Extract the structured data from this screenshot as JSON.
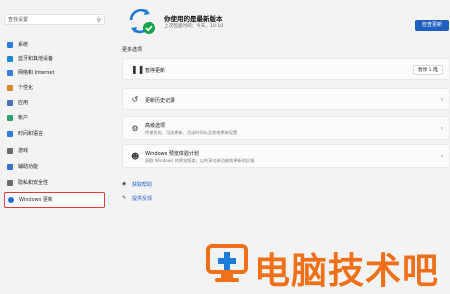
{
  "sidebar": {
    "search_placeholder": "查找设置",
    "items": [
      {
        "label": "系统",
        "icon": "system-icon",
        "color": "#2b7de0"
      },
      {
        "label": "蓝牙和其他设备",
        "icon": "bluetooth-icon",
        "color": "#1b8ad4"
      },
      {
        "label": "网络和 Internet",
        "icon": "network-icon",
        "color": "#3a7fd5"
      },
      {
        "label": "个性化",
        "icon": "personalization-icon",
        "color": "#d98b2b"
      },
      {
        "label": "应用",
        "icon": "apps-icon",
        "color": "#4a6fb8"
      },
      {
        "label": "帐户",
        "icon": "accounts-icon",
        "color": "#2fa26b"
      },
      {
        "label": "时间和语言",
        "icon": "time-language-icon",
        "color": "#2b7de0"
      },
      {
        "label": "游戏",
        "icon": "gaming-icon",
        "color": "#6a6a6a"
      },
      {
        "label": "辅助功能",
        "icon": "accessibility-icon",
        "color": "#3b6fc9"
      },
      {
        "label": "隐私和安全性",
        "icon": "privacy-icon",
        "color": "#6b6b6b"
      },
      {
        "label": "Windows 更新",
        "icon": "windows-update-icon",
        "color": "#1f6fd0",
        "active": true
      }
    ]
  },
  "main": {
    "status_title": "你使用的是最新版本",
    "status_sub": "上次检查时间：今天，10:10",
    "check_button": "检查更新",
    "more_options": "更多选项",
    "cards": [
      {
        "title": "暂停更新",
        "sub": "",
        "icon": "pause-icon",
        "dropdown": "暂停 1 周"
      },
      {
        "title": "更新历史记录",
        "sub": "",
        "icon": "history-icon"
      },
      {
        "title": "高级选项",
        "sub": "传递优化、可选更新、活动时间以及其他更新设置",
        "icon": "gear-icon"
      },
      {
        "title": "Windows 预览体验计划",
        "sub": "获取 Windows 的预览版本，以共享对新功能和更新的反馈",
        "icon": "insider-icon"
      }
    ],
    "links": [
      {
        "label": "获取帮助",
        "icon": "help-icon"
      },
      {
        "label": "提供反馈",
        "icon": "feedback-icon"
      }
    ]
  },
  "watermark": {
    "text": "电脑技术吧"
  },
  "colors": {
    "accent": "#1f5fbf",
    "highlight": "#e23838",
    "watermark": "#f0701a"
  }
}
